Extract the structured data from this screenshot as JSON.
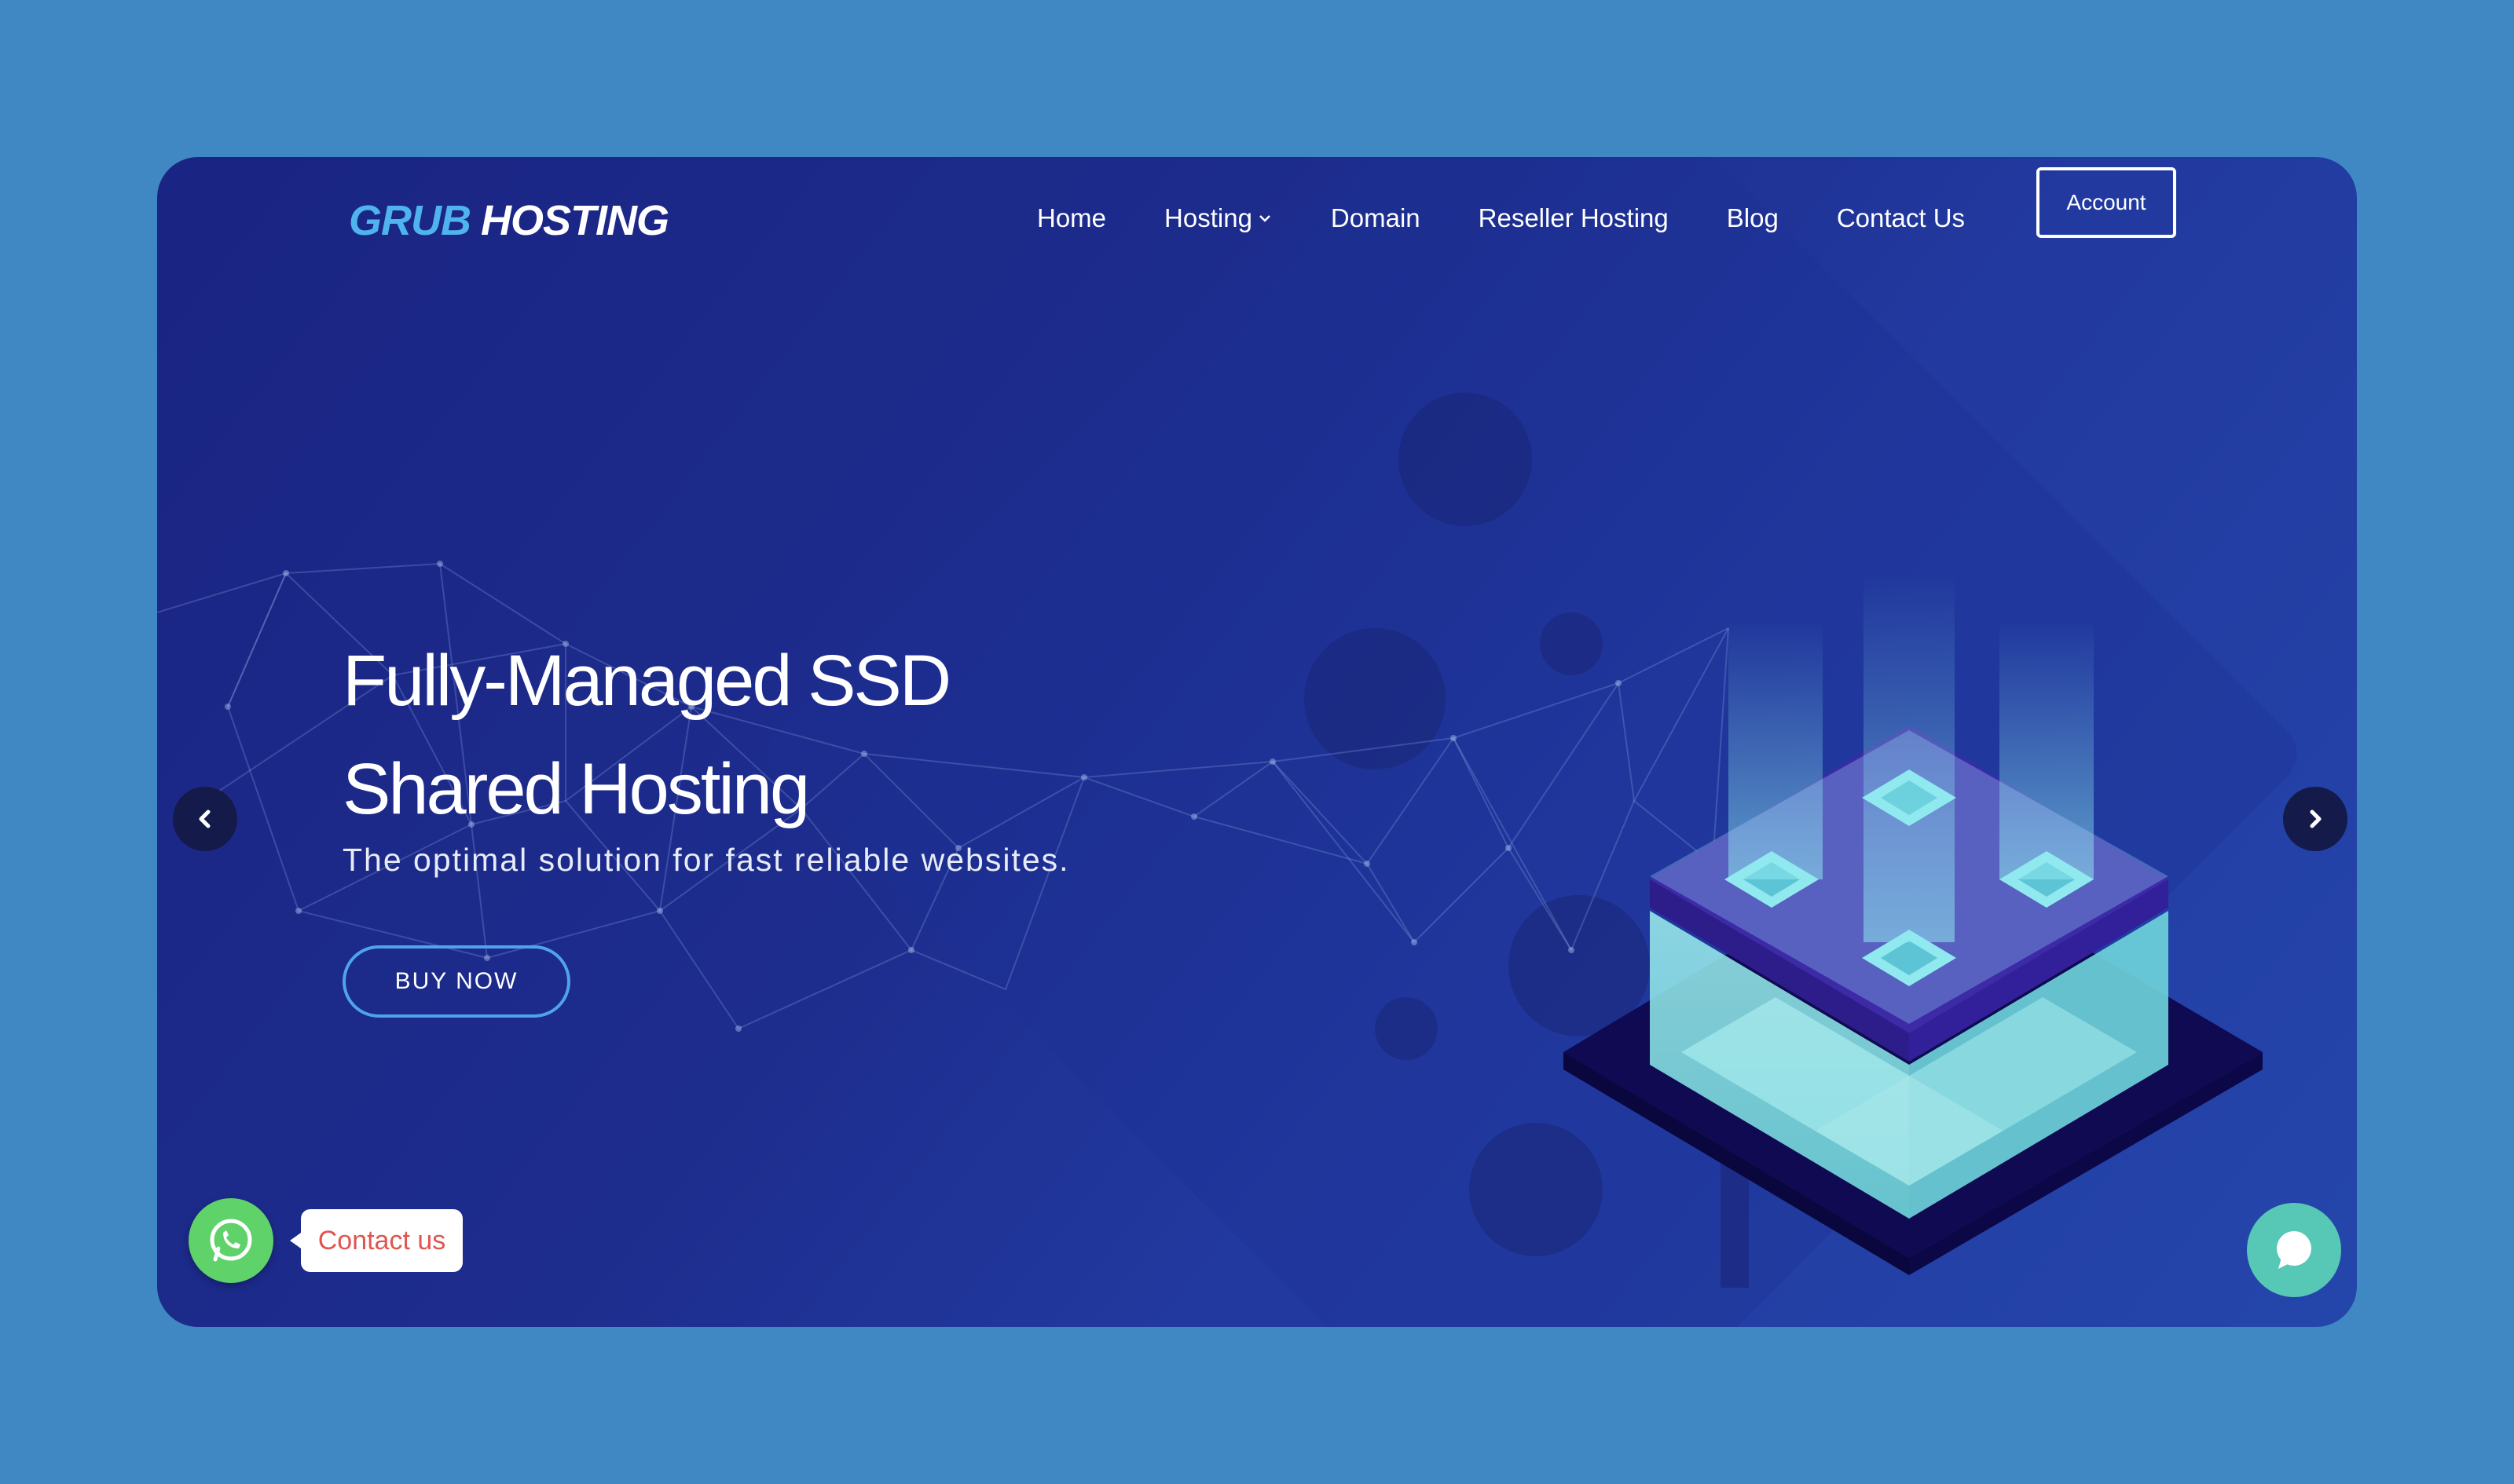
{
  "header": {
    "logo_part1": "GRUB",
    "logo_part2": "HOSTING",
    "nav": [
      {
        "label": "Home"
      },
      {
        "label": "Hosting"
      },
      {
        "label": "Domain"
      },
      {
        "label": "Reseller Hosting"
      },
      {
        "label": "Blog"
      },
      {
        "label": "Contact Us"
      }
    ],
    "account_label": "Account"
  },
  "hero": {
    "title_line1": "Fully-Managed SSD",
    "title_line2": "Shared Hosting",
    "subtitle": "The optimal solution for fast reliable websites.",
    "cta_label": "BUY NOW"
  },
  "widgets": {
    "whatsapp_label": "Contact us"
  },
  "colors": {
    "page_bg": "#3f88c3",
    "hero_bg": "#1d2d8e",
    "logo_accent": "#4fb3ee",
    "cta_border": "#4fa3ee",
    "whatsapp": "#5fd26a",
    "chat": "#57c7b6",
    "server_cyan": "#7fe3e0",
    "server_purple": "#3d2aa6"
  },
  "icons": {
    "prev": "chevron-left-icon",
    "next": "chevron-right-icon",
    "whatsapp": "whatsapp-icon",
    "chat": "chat-bubble-icon",
    "dropdown": "chevron-down-icon"
  }
}
